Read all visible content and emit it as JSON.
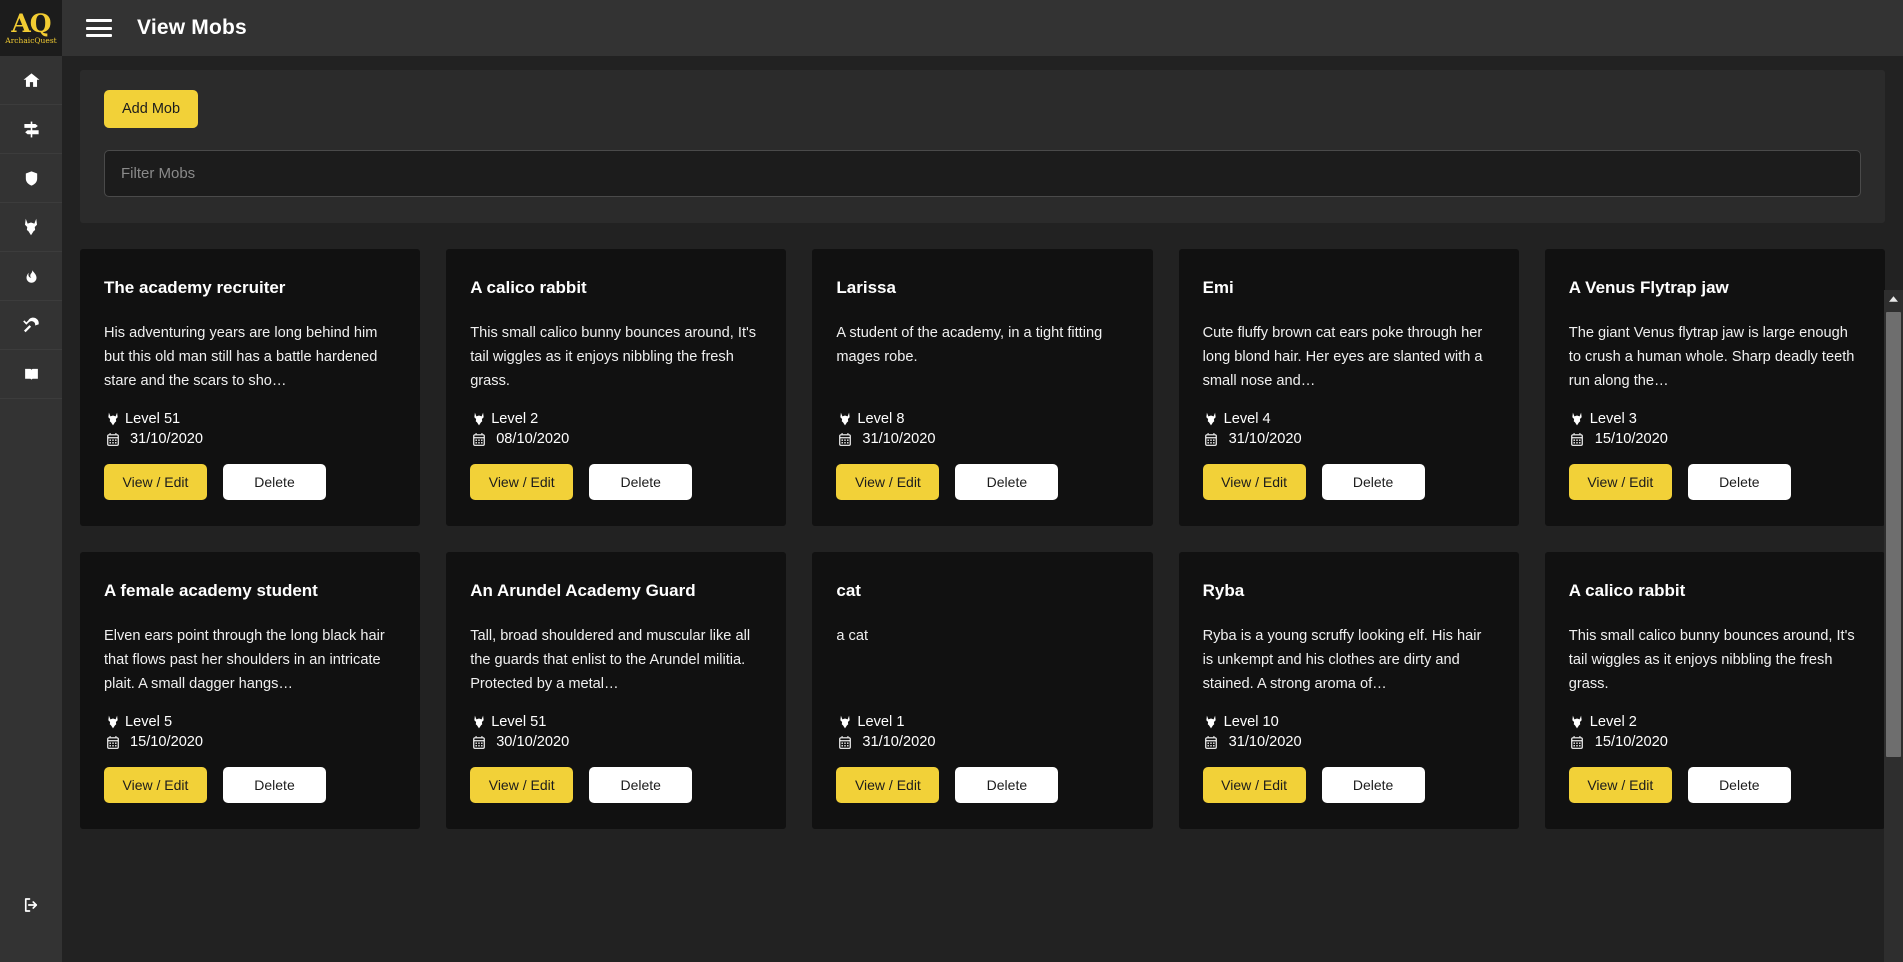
{
  "brand": {
    "mark": "AQ",
    "name": "ArchaicQuest"
  },
  "topbar": {
    "title": "View Mobs",
    "menu_icon": "hamburger-icon"
  },
  "sidebar": {
    "items": [
      {
        "icon": "home-icon",
        "name": "home"
      },
      {
        "icon": "map-signs-icon",
        "name": "rooms"
      },
      {
        "icon": "shield-icon",
        "name": "items"
      },
      {
        "icon": "wolf-head-icon",
        "name": "mobs"
      },
      {
        "icon": "fire-icon",
        "name": "skills"
      },
      {
        "icon": "axe-icon",
        "name": "crafting"
      },
      {
        "icon": "book-icon",
        "name": "help"
      }
    ],
    "logout": {
      "icon": "sign-out-icon",
      "name": "logout"
    }
  },
  "toolbar": {
    "add_label": "Add Mob",
    "filter_placeholder": "Filter Mobs",
    "filter_value": ""
  },
  "card_actions": {
    "view_label": "View / Edit",
    "delete_label": "Delete"
  },
  "labels": {
    "level_prefix": "Level",
    "level_icon": "wolf-head-icon",
    "date_icon": "calendar-icon"
  },
  "colors": {
    "accent_yellow": "#f2d138",
    "sidebar_bg": "#333333",
    "page_bg": "#222222",
    "card_bg": "#111111",
    "panel_bg": "#2b2b2b",
    "text_white": "#ffffff"
  },
  "mobs": [
    {
      "title": "The academy recruiter",
      "description": "His adventuring years are long behind him but this old man still has a battle hardened stare and the scars to sho…",
      "level": "Level 51",
      "date": "31/10/2020"
    },
    {
      "title": "A calico rabbit",
      "description": "This small calico bunny bounces around, It's tail wiggles as it enjoys nibbling the fresh grass.",
      "level": "Level 2",
      "date": "08/10/2020"
    },
    {
      "title": "Larissa",
      "description": "A student of the academy, in a tight fitting mages robe.",
      "level": "Level 8",
      "date": "31/10/2020"
    },
    {
      "title": "Emi",
      "description": "Cute fluffy brown cat ears poke through her long blond hair. Her eyes are slanted with a small nose and…",
      "level": "Level 4",
      "date": "31/10/2020"
    },
    {
      "title": "A Venus Flytrap jaw",
      "description": "The giant Venus flytrap jaw is large enough to crush a human whole. Sharp deadly teeth run along the…",
      "level": "Level 3",
      "date": "15/10/2020"
    },
    {
      "title": "A female academy student",
      "description": "Elven ears point through the long black hair that flows past her shoulders in an intricate plait. A small dagger hangs…",
      "level": "Level 5",
      "date": "15/10/2020"
    },
    {
      "title": "An Arundel Academy Guard",
      "description": "Tall, broad shouldered and muscular like all the guards that enlist to the Arundel militia. Protected by a metal…",
      "level": "Level 51",
      "date": "30/10/2020"
    },
    {
      "title": "cat",
      "description": "a cat",
      "level": "Level 1",
      "date": "31/10/2020"
    },
    {
      "title": "Ryba",
      "description": "Ryba is a young scruffy looking elf. His hair is unkempt and his clothes are dirty and stained. A strong aroma of…",
      "level": "Level 10",
      "date": "31/10/2020"
    },
    {
      "title": "A calico rabbit",
      "description": "This small calico bunny bounces around, It's tail wiggles as it enjoys nibbling the fresh grass.",
      "level": "Level 2",
      "date": "15/10/2020"
    }
  ],
  "scrollbar": {
    "up_arrow_icon": "chevron-up-icon"
  }
}
